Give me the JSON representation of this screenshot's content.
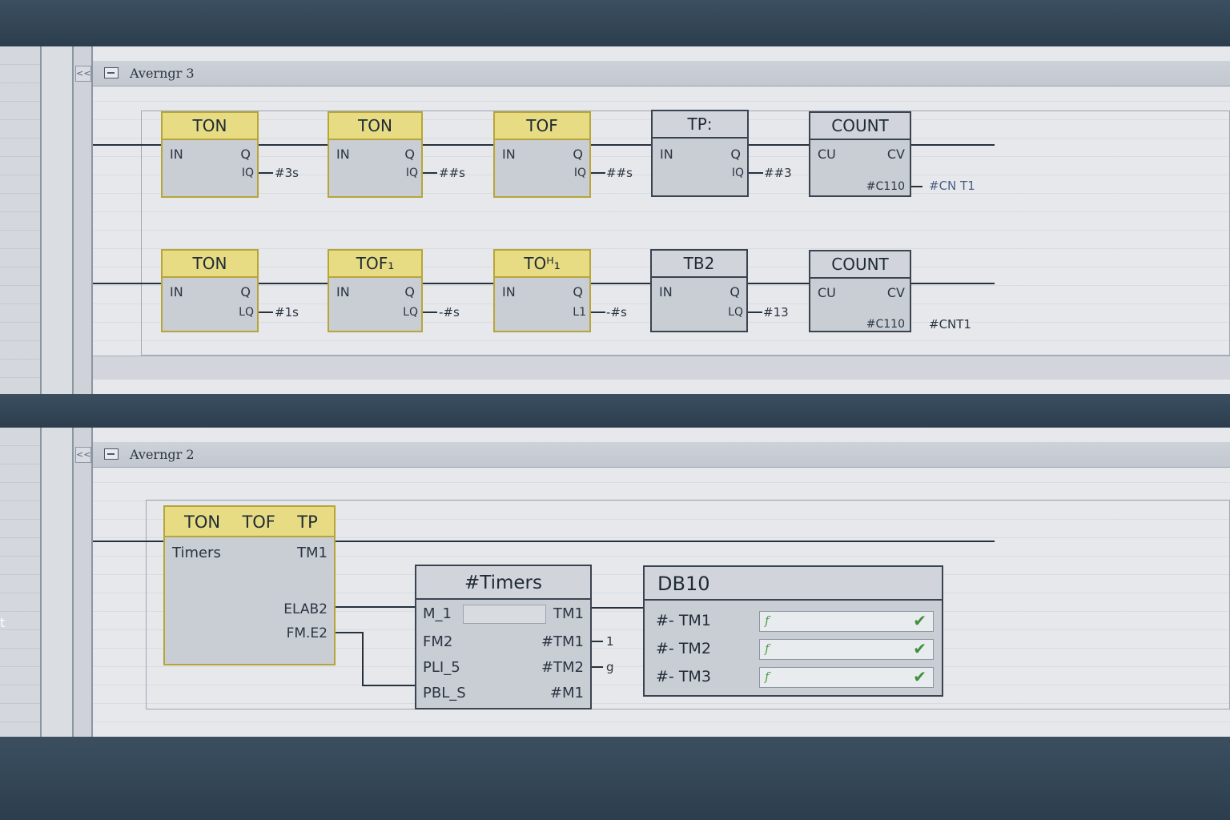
{
  "networks": [
    {
      "collapse_label": "<<",
      "title": "Averngr 3",
      "rows": [
        [
          {
            "header": "TON",
            "in": "IN",
            "q": "Q",
            "sub": "IQ",
            "out": "#3s"
          },
          {
            "header": "TON",
            "in": "IN",
            "q": "Q",
            "sub": "IQ",
            "out": "##s"
          },
          {
            "header": "TOF",
            "in": "IN",
            "q": "Q",
            "sub": "IQ",
            "out": "##s"
          },
          {
            "header": "TP:",
            "in": "IN",
            "q": "Q",
            "sub": "IQ",
            "out": "##3"
          },
          {
            "header": "COUNT",
            "in": "CU",
            "q": "CV",
            "sub": "#C110",
            "out": "#CN T1"
          }
        ],
        [
          {
            "header": "TON",
            "in": "IN",
            "q": "Q",
            "sub": "LQ",
            "out": "#1s"
          },
          {
            "header": "TOF₁",
            "in": "IN",
            "q": "Q",
            "sub": "LQ",
            "out": "-#s"
          },
          {
            "header": "TOᴴ₁",
            "in": "IN",
            "q": "Q",
            "sub": "L1",
            "out": "-#s"
          },
          {
            "header": "TB2",
            "in": "IN",
            "q": "Q",
            "sub": "LQ",
            "out": "#13"
          },
          {
            "header": "COUNT",
            "in": "CU",
            "q": "CV",
            "sub": "#C110",
            "out": "#CNT1"
          }
        ]
      ]
    },
    {
      "collapse_label": "<<",
      "title": "Averngr 2",
      "timer_block": {
        "header_items": [
          "TON",
          "TOF",
          "TP"
        ],
        "left_pin": "Timers",
        "right_pin": "TM1",
        "out1": "ELAB2",
        "out2": "FM.E2"
      },
      "timers_block": {
        "header": "#Timers",
        "left_pins": [
          "M_1",
          "FM2",
          "PLI_5",
          "PBL_S"
        ],
        "right_pins": [
          "TM1",
          "#TM1",
          "#TM2",
          "#M1"
        ],
        "right_outs": [
          "1",
          "g"
        ]
      },
      "db_block": {
        "header": "DB10",
        "rows": [
          {
            "label": "#- TM1",
            "value": "f",
            "check": "✔"
          },
          {
            "label": "#- TM2",
            "value": "f",
            "check": "✔"
          },
          {
            "label": "#- TM3",
            "value": "f",
            "check": "✔"
          }
        ]
      }
    }
  ],
  "edge_text": "t",
  "colors": {
    "background": "#2f4252",
    "panel": "#e6e8ec",
    "block_header_yellow": "#e7dc83",
    "block_border_yellow": "#b8a53a",
    "check_green": "#3f8f3c"
  }
}
